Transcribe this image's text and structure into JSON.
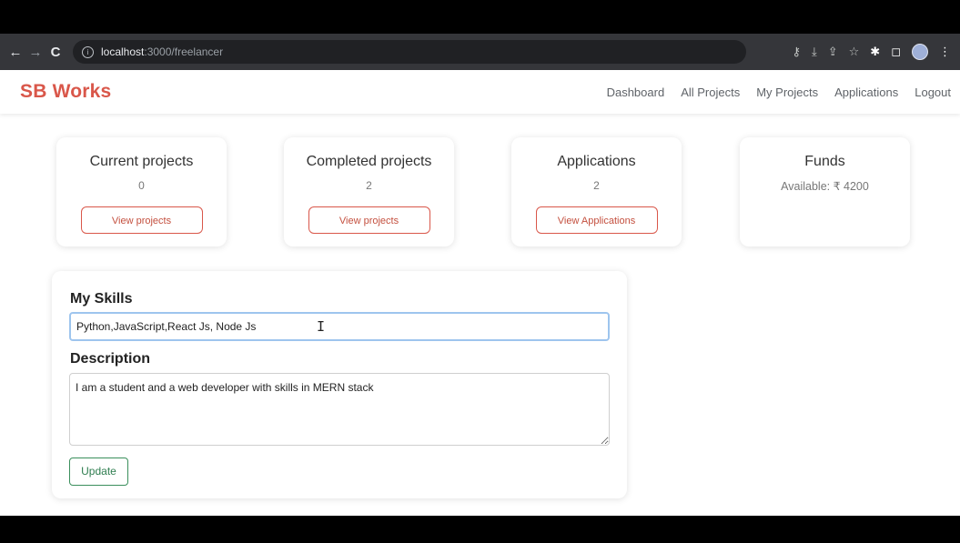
{
  "browser": {
    "url_host": "localhost",
    "url_path": ":3000/freelancer",
    "back_icon": "←",
    "forward_icon": "→",
    "reload_icon": "C",
    "toolbar_icons": [
      "key-icon",
      "install-icon",
      "share-icon",
      "star-icon",
      "extensions-icon",
      "sidepanel-icon",
      "avatar",
      "menu-icon"
    ]
  },
  "navbar": {
    "brand": "SB Works",
    "links": [
      "Dashboard",
      "All Projects",
      "My Projects",
      "Applications",
      "Logout"
    ]
  },
  "cards": [
    {
      "title": "Current projects",
      "value": "0",
      "button": "View projects"
    },
    {
      "title": "Completed projects",
      "value": "2",
      "button": "View projects"
    },
    {
      "title": "Applications",
      "value": "2",
      "button": "View Applications"
    },
    {
      "title": "Funds",
      "value": "Available: ₹ 4200"
    }
  ],
  "form": {
    "skills_label": "My Skills",
    "skills_value": "Python,JavaScript,React Js, Node Js",
    "description_label": "Description",
    "description_value": "I am a student and a web developer with skills in MERN stack",
    "update_button": "Update"
  },
  "colors": {
    "brand": "#d9574a",
    "update_button": "#3a8f5c",
    "focus_border": "#9ec5ee"
  }
}
